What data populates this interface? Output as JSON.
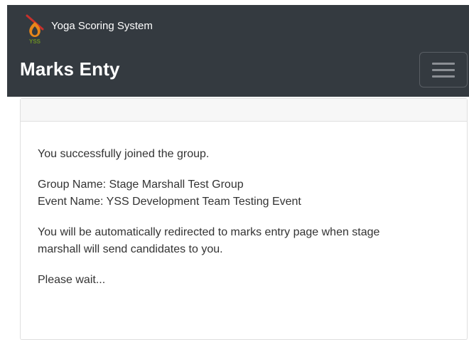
{
  "navbar": {
    "brand_text": "Yoga Scoring System",
    "logo_text": "YSS",
    "page_title": "Marks Enty",
    "menu_icon": "hamburger-icon"
  },
  "card": {
    "success_message": "You successfully joined the group.",
    "group_name": "Group Name: Stage Marshall Test Group",
    "event_name": "Event Name: YSS Development Team Testing Event",
    "redirect_line1": "You will be automatically redirected to marks entry page when stage",
    "redirect_line2": "marshall will send candidates to you.",
    "wait_message": "Please wait..."
  },
  "colors": {
    "navbar_bg": "#343a40",
    "card_header_bg": "#f7f7f7",
    "logo_red": "#c9302c",
    "logo_orange": "#e8861a",
    "logo_green": "#6b8e23"
  }
}
